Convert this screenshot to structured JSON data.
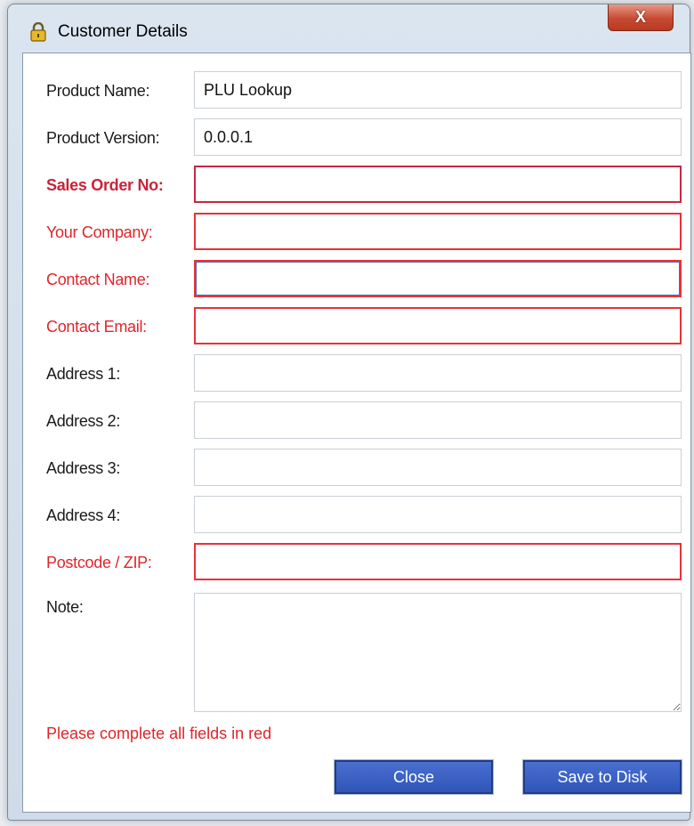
{
  "window": {
    "title": "Customer Details",
    "close_glyph": "X"
  },
  "fields": {
    "product_name": {
      "label": "Product Name:",
      "value": "PLU Lookup"
    },
    "product_version": {
      "label": "Product Version:",
      "value": "0.0.0.1"
    },
    "sales_order_no": {
      "label": "Sales Order No:",
      "value": ""
    },
    "your_company": {
      "label": "Your Company:",
      "value": ""
    },
    "contact_name": {
      "label": "Contact Name:",
      "value": ""
    },
    "contact_email": {
      "label": "Contact Email:",
      "value": ""
    },
    "address1": {
      "label": "Address 1:",
      "value": ""
    },
    "address2": {
      "label": "Address 2:",
      "value": ""
    },
    "address3": {
      "label": "Address 3:",
      "value": ""
    },
    "address4": {
      "label": "Address 4:",
      "value": ""
    },
    "postcode": {
      "label": "Postcode / ZIP:",
      "value": ""
    },
    "note": {
      "label": "Note:",
      "value": ""
    }
  },
  "warning": "Please complete all fields in red",
  "buttons": {
    "close": "Close",
    "save": "Save to Disk"
  },
  "colors": {
    "required": "#e0252b",
    "button": "#3a60c4"
  },
  "icons": {
    "title": "padlock-icon",
    "close": "close-icon"
  }
}
